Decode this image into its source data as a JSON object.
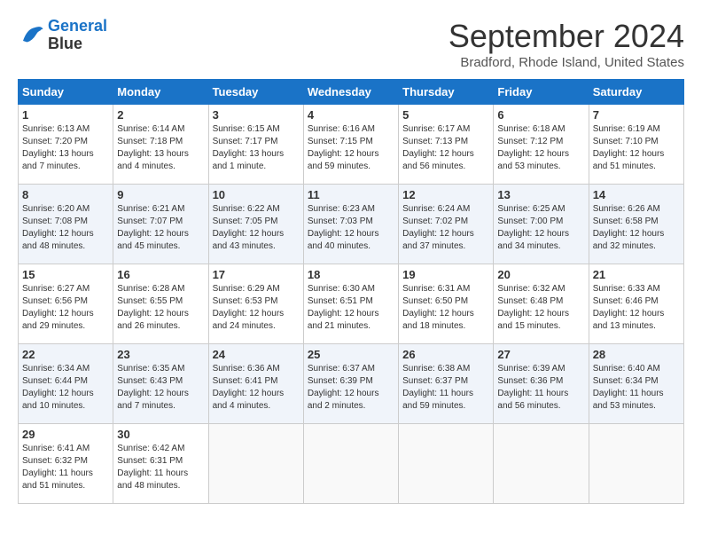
{
  "header": {
    "logo_line1": "General",
    "logo_line2": "Blue",
    "month_title": "September 2024",
    "location": "Bradford, Rhode Island, United States"
  },
  "calendar": {
    "days_of_week": [
      "Sunday",
      "Monday",
      "Tuesday",
      "Wednesday",
      "Thursday",
      "Friday",
      "Saturday"
    ],
    "weeks": [
      [
        {
          "day": "1",
          "sunrise": "6:13 AM",
          "sunset": "7:20 PM",
          "daylight": "13 hours and 7 minutes."
        },
        {
          "day": "2",
          "sunrise": "6:14 AM",
          "sunset": "7:18 PM",
          "daylight": "13 hours and 4 minutes."
        },
        {
          "day": "3",
          "sunrise": "6:15 AM",
          "sunset": "7:17 PM",
          "daylight": "13 hours and 1 minute."
        },
        {
          "day": "4",
          "sunrise": "6:16 AM",
          "sunset": "7:15 PM",
          "daylight": "12 hours and 59 minutes."
        },
        {
          "day": "5",
          "sunrise": "6:17 AM",
          "sunset": "7:13 PM",
          "daylight": "12 hours and 56 minutes."
        },
        {
          "day": "6",
          "sunrise": "6:18 AM",
          "sunset": "7:12 PM",
          "daylight": "12 hours and 53 minutes."
        },
        {
          "day": "7",
          "sunrise": "6:19 AM",
          "sunset": "7:10 PM",
          "daylight": "12 hours and 51 minutes."
        }
      ],
      [
        {
          "day": "8",
          "sunrise": "6:20 AM",
          "sunset": "7:08 PM",
          "daylight": "12 hours and 48 minutes."
        },
        {
          "day": "9",
          "sunrise": "6:21 AM",
          "sunset": "7:07 PM",
          "daylight": "12 hours and 45 minutes."
        },
        {
          "day": "10",
          "sunrise": "6:22 AM",
          "sunset": "7:05 PM",
          "daylight": "12 hours and 43 minutes."
        },
        {
          "day": "11",
          "sunrise": "6:23 AM",
          "sunset": "7:03 PM",
          "daylight": "12 hours and 40 minutes."
        },
        {
          "day": "12",
          "sunrise": "6:24 AM",
          "sunset": "7:02 PM",
          "daylight": "12 hours and 37 minutes."
        },
        {
          "day": "13",
          "sunrise": "6:25 AM",
          "sunset": "7:00 PM",
          "daylight": "12 hours and 34 minutes."
        },
        {
          "day": "14",
          "sunrise": "6:26 AM",
          "sunset": "6:58 PM",
          "daylight": "12 hours and 32 minutes."
        }
      ],
      [
        {
          "day": "15",
          "sunrise": "6:27 AM",
          "sunset": "6:56 PM",
          "daylight": "12 hours and 29 minutes."
        },
        {
          "day": "16",
          "sunrise": "6:28 AM",
          "sunset": "6:55 PM",
          "daylight": "12 hours and 26 minutes."
        },
        {
          "day": "17",
          "sunrise": "6:29 AM",
          "sunset": "6:53 PM",
          "daylight": "12 hours and 24 minutes."
        },
        {
          "day": "18",
          "sunrise": "6:30 AM",
          "sunset": "6:51 PM",
          "daylight": "12 hours and 21 minutes."
        },
        {
          "day": "19",
          "sunrise": "6:31 AM",
          "sunset": "6:50 PM",
          "daylight": "12 hours and 18 minutes."
        },
        {
          "day": "20",
          "sunrise": "6:32 AM",
          "sunset": "6:48 PM",
          "daylight": "12 hours and 15 minutes."
        },
        {
          "day": "21",
          "sunrise": "6:33 AM",
          "sunset": "6:46 PM",
          "daylight": "12 hours and 13 minutes."
        }
      ],
      [
        {
          "day": "22",
          "sunrise": "6:34 AM",
          "sunset": "6:44 PM",
          "daylight": "12 hours and 10 minutes."
        },
        {
          "day": "23",
          "sunrise": "6:35 AM",
          "sunset": "6:43 PM",
          "daylight": "12 hours and 7 minutes."
        },
        {
          "day": "24",
          "sunrise": "6:36 AM",
          "sunset": "6:41 PM",
          "daylight": "12 hours and 4 minutes."
        },
        {
          "day": "25",
          "sunrise": "6:37 AM",
          "sunset": "6:39 PM",
          "daylight": "12 hours and 2 minutes."
        },
        {
          "day": "26",
          "sunrise": "6:38 AM",
          "sunset": "6:37 PM",
          "daylight": "11 hours and 59 minutes."
        },
        {
          "day": "27",
          "sunrise": "6:39 AM",
          "sunset": "6:36 PM",
          "daylight": "11 hours and 56 minutes."
        },
        {
          "day": "28",
          "sunrise": "6:40 AM",
          "sunset": "6:34 PM",
          "daylight": "11 hours and 53 minutes."
        }
      ],
      [
        {
          "day": "29",
          "sunrise": "6:41 AM",
          "sunset": "6:32 PM",
          "daylight": "11 hours and 51 minutes."
        },
        {
          "day": "30",
          "sunrise": "6:42 AM",
          "sunset": "6:31 PM",
          "daylight": "11 hours and 48 minutes."
        },
        {
          "day": "",
          "sunrise": "",
          "sunset": "",
          "daylight": ""
        },
        {
          "day": "",
          "sunrise": "",
          "sunset": "",
          "daylight": ""
        },
        {
          "day": "",
          "sunrise": "",
          "sunset": "",
          "daylight": ""
        },
        {
          "day": "",
          "sunrise": "",
          "sunset": "",
          "daylight": ""
        },
        {
          "day": "",
          "sunrise": "",
          "sunset": "",
          "daylight": ""
        }
      ]
    ]
  }
}
